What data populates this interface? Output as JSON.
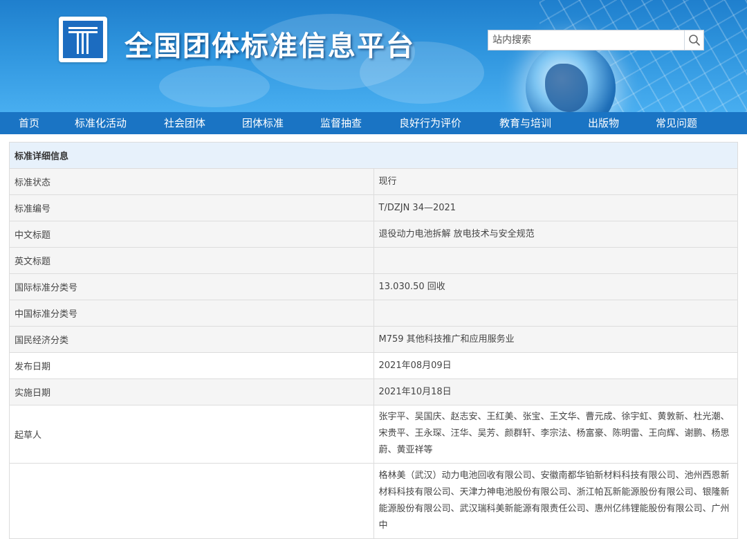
{
  "header": {
    "site_title": "全国团体标准信息平台",
    "search_placeholder": "站内搜索",
    "logo_icon": "platform-logo-icon",
    "search_icon": "search-icon"
  },
  "nav": {
    "items": [
      "首页",
      "标准化活动",
      "社会团体",
      "团体标准",
      "监督抽查",
      "良好行为评价",
      "教育与培训",
      "出版物",
      "常见问题"
    ]
  },
  "detail": {
    "section_title": "标准详细信息",
    "rows": [
      {
        "label": "标准状态",
        "value": "现行"
      },
      {
        "label": "标准编号",
        "value": "T/DZJN 34—2021"
      },
      {
        "label": "中文标题",
        "value": "退役动力电池拆解 放电技术与安全规范"
      },
      {
        "label": "英文标题",
        "value": ""
      },
      {
        "label": "国际标准分类号",
        "value": "13.030.50 回收"
      },
      {
        "label": "中国标准分类号",
        "value": ""
      },
      {
        "label": "国民经济分类",
        "value": "M759 其他科技推广和应用服务业"
      },
      {
        "label": "发布日期",
        "value": "2021年08月09日"
      },
      {
        "label": "实施日期",
        "value": "2021年10月18日"
      },
      {
        "label": "起草人",
        "value": "张宇平、吴国庆、赵志安、王红美、张宝、王文华、曹元成、徐宇虹、黄敦新、杜光潮、宋贵平、王永琛、汪华、吴芳、颜群轩、李宗法、杨富豪、陈明雷、王向辉、谢鹏、杨思蔚、黄亚祥等"
      },
      {
        "label": "",
        "value": "格林美（武汉）动力电池回收有限公司、安徽南都华铂新材料科技有限公司、池州西恩新材料科技有限公司、天津力神电池股份有限公司、浙江帕瓦新能源股份有限公司、银隆新能源股份有限公司、武汉瑞科美新能源有限责任公司、惠州亿纬锂能股份有限公司、广州中"
      }
    ]
  },
  "colors": {
    "nav_bg": "#1a74c4",
    "section_header_bg": "#e7f1fb",
    "row_alt_bg": "#f5f5f5"
  }
}
